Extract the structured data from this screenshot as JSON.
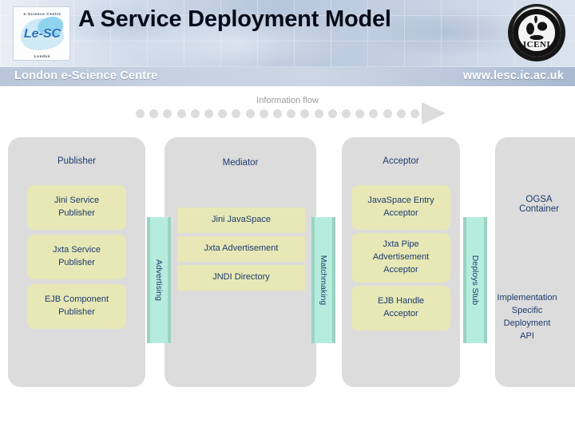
{
  "banner": {
    "title": "A Service Deployment Model",
    "org_name": "London e-Science Centre",
    "website": "www.lesc.ic.ac.uk",
    "lesc_logo": {
      "wordmark": "Le-SC",
      "arc_top": "e-Science Centre",
      "arc_bottom": "London"
    },
    "iceni_logo": {
      "wordmark": "ICENI"
    }
  },
  "flow": {
    "label": "Information flow",
    "dot_count": 21,
    "dot_color": "#dcdcdc"
  },
  "colors": {
    "column_bg": "#dcdcdc",
    "node_bg": "#e7e8b6",
    "band_bg": "#b6ecdd",
    "band_edge": "#9ad3c1",
    "text": "#1f3a6e"
  },
  "diagram": {
    "columns": [
      {
        "id": "publisher",
        "title": "Publisher",
        "nodes": [
          {
            "label": "Jini Service\nPublisher"
          },
          {
            "label": "Jxta Service\nPublisher"
          },
          {
            "label": "EJB Component\nPublisher"
          }
        ]
      },
      {
        "id": "mediator",
        "title": "Mediator",
        "nodes": [
          {
            "label": "Jini JavaSpace"
          },
          {
            "label": "Jxta Advertisement"
          },
          {
            "label": "JNDI Directory"
          }
        ]
      },
      {
        "id": "acceptor",
        "title": "Acceptor",
        "nodes": [
          {
            "label": "JavaSpace Entry\nAcceptor"
          },
          {
            "label": "Jxta Pipe\nAdvertisement\nAcceptor"
          },
          {
            "label": "EJB Handle\nAcceptor"
          }
        ]
      },
      {
        "id": "ogsa-container",
        "title": "OGSA\nContainer",
        "nodes": [
          {
            "label": "Implementation\nSpecific\nDeployment\nAPI"
          }
        ]
      }
    ],
    "bands": [
      {
        "id": "advertising",
        "label": "Advertising"
      },
      {
        "id": "matchmaking",
        "label": "Matchmaking"
      },
      {
        "id": "deploys-stub",
        "label": "Deploys Stub"
      }
    ]
  }
}
